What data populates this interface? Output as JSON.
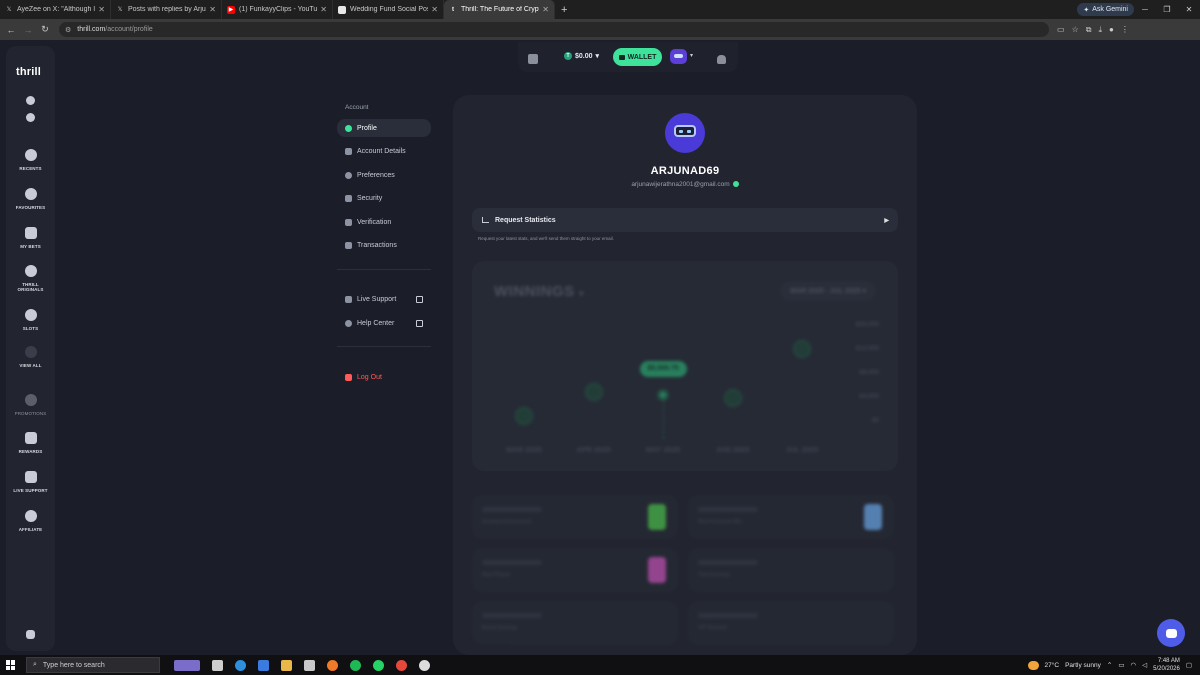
{
  "browser": {
    "tabs": [
      {
        "label": "AyeZee on X: \"Although I've m",
        "icon": "x-logo-icon",
        "active": false
      },
      {
        "label": "Posts with replies by Arjuna D",
        "icon": "x-logo-icon",
        "active": false
      },
      {
        "label": "(1) FunkayyClips - YouTube",
        "icon": "youtube-icon",
        "active": false
      },
      {
        "label": "Wedding Fund Social Post",
        "icon": "doc-icon",
        "active": false
      },
      {
        "label": "Thrill: The Future of Crypto Cas",
        "icon": "thrill-icon",
        "active": true
      }
    ],
    "ask_gemini": "Ask Gemini",
    "url_host": "thrill.com",
    "url_path": "/account/profile"
  },
  "sidebar": {
    "logo": "thrill",
    "items": [
      {
        "label": "RECENTS",
        "icon": "history-icon"
      },
      {
        "label": "FAVOURITES",
        "icon": "heart-icon"
      },
      {
        "label": "MY BETS",
        "icon": "receipt-icon"
      },
      {
        "label": "THRILL ORIGINALS",
        "icon": "diamond-icon"
      },
      {
        "label": "SLOTS",
        "icon": "cherries-icon"
      },
      {
        "label": "VIEW ALL",
        "icon": "more-icon"
      },
      {
        "label": "PROMOTIONS",
        "icon": "promo-icon"
      },
      {
        "label": "REWARDS",
        "icon": "gift-icon"
      },
      {
        "label": "LIVE SUPPORT",
        "icon": "chat-icon"
      },
      {
        "label": "AFFILIATE",
        "icon": "handshake-icon"
      }
    ]
  },
  "topbar": {
    "balance": "$0.00",
    "wallet_label": "WALLET",
    "accent": "#3ee29b"
  },
  "account_menu": {
    "heading": "Account",
    "items": [
      {
        "label": "Profile",
        "active": true
      },
      {
        "label": "Account Details"
      },
      {
        "label": "Preferences"
      },
      {
        "label": "Security"
      },
      {
        "label": "Verification"
      },
      {
        "label": "Transactions"
      }
    ],
    "support": [
      {
        "label": "Live Support"
      },
      {
        "label": "Help Center"
      }
    ],
    "logout": "Log Out"
  },
  "profile": {
    "username": "ARJUNAD69",
    "email": "arjunawijerathna2001@gmail.com",
    "request_stats_label": "Request Statistics",
    "request_stats_hint": "Request your latest stats, and we'll send them straight to your email."
  },
  "chart_data": {
    "type": "scatter",
    "title": "WINNINGS",
    "range_label": "MAR 2025 - JUL 2025",
    "categories": [
      "MAR 2025",
      "APR 2025",
      "MAY 2025",
      "JUN 2025",
      "JUL 2025"
    ],
    "values": [
      1000,
      6000,
      5500.75,
      4800,
      15000
    ],
    "highlight": {
      "category": "MAY 2025",
      "label": "$5,500.75"
    },
    "y_ticks": [
      "$20,000",
      "$12,000",
      "$8,000",
      "$4,000",
      "$0"
    ],
    "ylim": [
      0,
      20000
    ]
  },
  "stats": [
    {
      "label": "Greatest Achievement"
    },
    {
      "label": "Most Fortunate Win"
    },
    {
      "label": "Most Played"
    },
    {
      "label": "Total Earnings"
    },
    {
      "label": "Bonus Earnings"
    },
    {
      "label": "VIP Rewards"
    }
  ],
  "taskbar": {
    "search_placeholder": "Type here to search",
    "temperature": "27°C",
    "weather": "Partly sunny",
    "time": "7:48 AM",
    "date": "5/20/2026"
  }
}
